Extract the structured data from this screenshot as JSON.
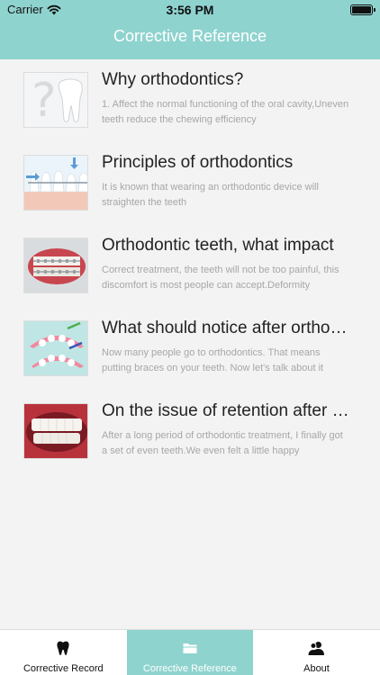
{
  "status_bar": {
    "carrier": "Carrier",
    "time": "3:56 PM"
  },
  "nav": {
    "title": "Corrective Reference"
  },
  "articles": [
    {
      "title": "Why orthodontics?",
      "description": "1. Affect the normal functioning of the oral cavity,Uneven teeth reduce the chewing efficiency",
      "thumbnail": "tooth-question-image"
    },
    {
      "title": "Principles of orthodontics",
      "description": "It is known that wearing an orthodontic device will straighten the teeth",
      "thumbnail": "braces-diagram-image"
    },
    {
      "title": "Orthodontic teeth, what impact",
      "description": "Correct treatment, the teeth will not be too painful, this discomfort is most people can accept.Deformity",
      "thumbnail": "braces-teeth-photo"
    },
    {
      "title": "What should notice after orthodontics",
      "description": "Now many people go to orthodontics. That means putting braces on your teeth. Now let's talk about it",
      "thumbnail": "cartoon-brushing-image"
    },
    {
      "title": "On the issue of retention after orthodontics",
      "description": "After a long period of orthodontic treatment, I finally got a set of even teeth.We even felt a little happy",
      "thumbnail": "retainer-teeth-photo"
    }
  ],
  "tabs": [
    {
      "label": "Corrective Record",
      "icon": "tooth-icon"
    },
    {
      "label": "Corrective Reference",
      "icon": "folder-icon"
    },
    {
      "label": "About",
      "icon": "people-icon"
    }
  ],
  "colors": {
    "accent": "#8fd3cf",
    "background": "#f3f3f3",
    "title_text": "#222222",
    "desc_text": "#a7a7a7"
  }
}
